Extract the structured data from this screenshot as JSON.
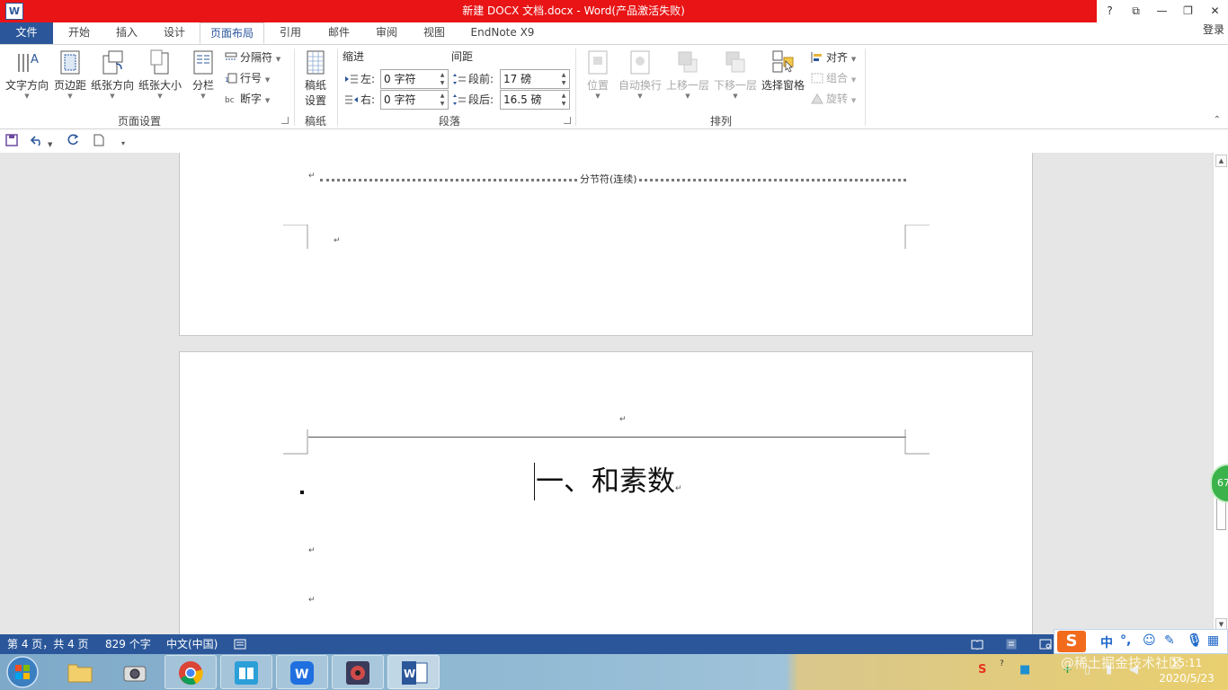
{
  "window": {
    "title": "新建 DOCX 文档.docx - Word(产品激活失败)",
    "app_icon": "W",
    "controls": [
      "?",
      "⧉",
      "—",
      "❐",
      "✕"
    ]
  },
  "tabs": [
    {
      "label": "文件"
    },
    {
      "label": "开始"
    },
    {
      "label": "插入"
    },
    {
      "label": "设计"
    },
    {
      "label": "页面布局"
    },
    {
      "label": "引用"
    },
    {
      "label": "邮件"
    },
    {
      "label": "审阅"
    },
    {
      "label": "视图"
    },
    {
      "label": "EndNote X9"
    }
  ],
  "login": "登录",
  "ribbon": {
    "page_setup": {
      "text_direction": "文字方向",
      "margins": "页边距",
      "orientation": "纸张方向",
      "size": "纸张大小",
      "columns": "分栏",
      "breaks": "分隔符",
      "line_numbers": "行号",
      "hyphenation": "断字",
      "group_label": "页面设置"
    },
    "manuscript": {
      "button": "稿纸",
      "button2": "设置",
      "group_label": "稿纸"
    },
    "paragraph": {
      "indent_label": "缩进",
      "spacing_label": "间距",
      "left_label": "左:",
      "right_label": "右:",
      "before_label": "段前:",
      "after_label": "段后:",
      "left_value": "0 字符",
      "right_value": "0 字符",
      "before_value": "17 磅",
      "after_value": "16.5 磅",
      "group_label": "段落"
    },
    "arrange": {
      "position": "位置",
      "wrap_text": "自动换行",
      "bring_forward": "上移一层",
      "send_backward": "下移一层",
      "selection_pane": "选择窗格",
      "align": "对齐",
      "group": "组合",
      "rotate": "旋转",
      "group_label": "排列"
    }
  },
  "document": {
    "section_break": "分节符(连续)",
    "heading": "一、和素数",
    "para_mark": "↵"
  },
  "scroll_badge": "67",
  "status": {
    "page": "第 4 页，共 4 页",
    "words": "829 个字",
    "language": "中文(中国)"
  },
  "ime": {
    "logo": "S",
    "mode": "中"
  },
  "clock": {
    "time": "15:11",
    "date": "2020/5/23"
  },
  "watermark": "@稀土掘金技术社区"
}
